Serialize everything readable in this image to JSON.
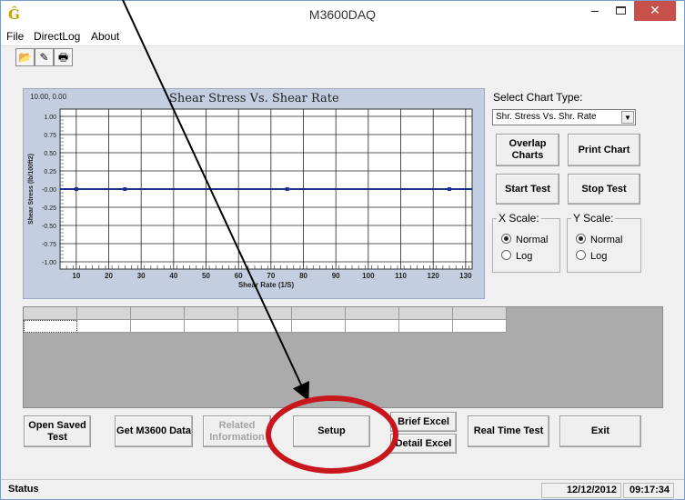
{
  "window": {
    "title": "M3600DAQ",
    "app_icon_glyph": "Ĝ",
    "minimize_glyph": "–",
    "close_glyph": "✕"
  },
  "menu": {
    "file": "File",
    "directlog": "DirectLog",
    "about": "About"
  },
  "toolbar": {
    "open_glyph": "📂",
    "run_glyph": "✎",
    "print_glyph": "🖶"
  },
  "chart": {
    "corner_readout": "10.00, 0.00",
    "title": "Shear Stress Vs. Shear Rate",
    "ylabel": "Shear Stress (lb/100ft2)",
    "xlabel": "Shear Rate (1/S)"
  },
  "chart_data": {
    "type": "line",
    "title": "Shear Stress Vs. Shear Rate",
    "xlabel": "Shear Rate (1/S)",
    "ylabel": "Shear Stress (lb/100ft2)",
    "xlim": [
      5,
      132
    ],
    "ylim": [
      -1.1,
      1.1
    ],
    "xticks": [
      10,
      20,
      30,
      40,
      50,
      60,
      70,
      80,
      90,
      100,
      110,
      120,
      130
    ],
    "yticks": [
      1.0,
      0.75,
      0.5,
      0.25,
      0.0,
      -0.25,
      -0.5,
      -0.75,
      -1.0
    ],
    "ytick_labels": [
      "1.00",
      "0.75",
      "0.50",
      "0.25",
      "-0.00",
      "-0.25",
      "-0.50",
      "-0.75",
      "-1.00"
    ],
    "grid": true,
    "series": [
      {
        "x": [
          5,
          10,
          25,
          75,
          125,
          132
        ],
        "y": [
          0,
          0,
          0,
          0,
          0,
          0
        ],
        "markers_at": [
          10,
          25,
          75,
          125
        ],
        "color": "#1c2f8c"
      }
    ]
  },
  "side_panel": {
    "select_label": "Select Chart Type:",
    "select_value": "Shr. Stress Vs. Shr. Rate",
    "overlap_charts": "Overlap Charts",
    "print_chart": "Print Chart",
    "start_test": "Start Test",
    "stop_test": "Stop Test",
    "x_scale_title": "X Scale:",
    "y_scale_title": "Y Scale:",
    "x_normal": "Normal",
    "x_log": "Log",
    "y_normal": "Normal",
    "y_log": "Log"
  },
  "buttons": {
    "open_saved_test": "Open Saved Test",
    "get_m3600_data": "Get M3600 Data",
    "related_information": "Related Information",
    "setup": "Setup",
    "brief_excel": "Brief Excel",
    "detail_excel": "Detail Excel",
    "real_time_test": "Real Time Test",
    "exit": "Exit"
  },
  "status": {
    "label": "Status",
    "date": "12/12/2012",
    "time": "09:17:34"
  },
  "annotation": {
    "arrow_color": "#000000",
    "circle_color": "#c8161d"
  }
}
